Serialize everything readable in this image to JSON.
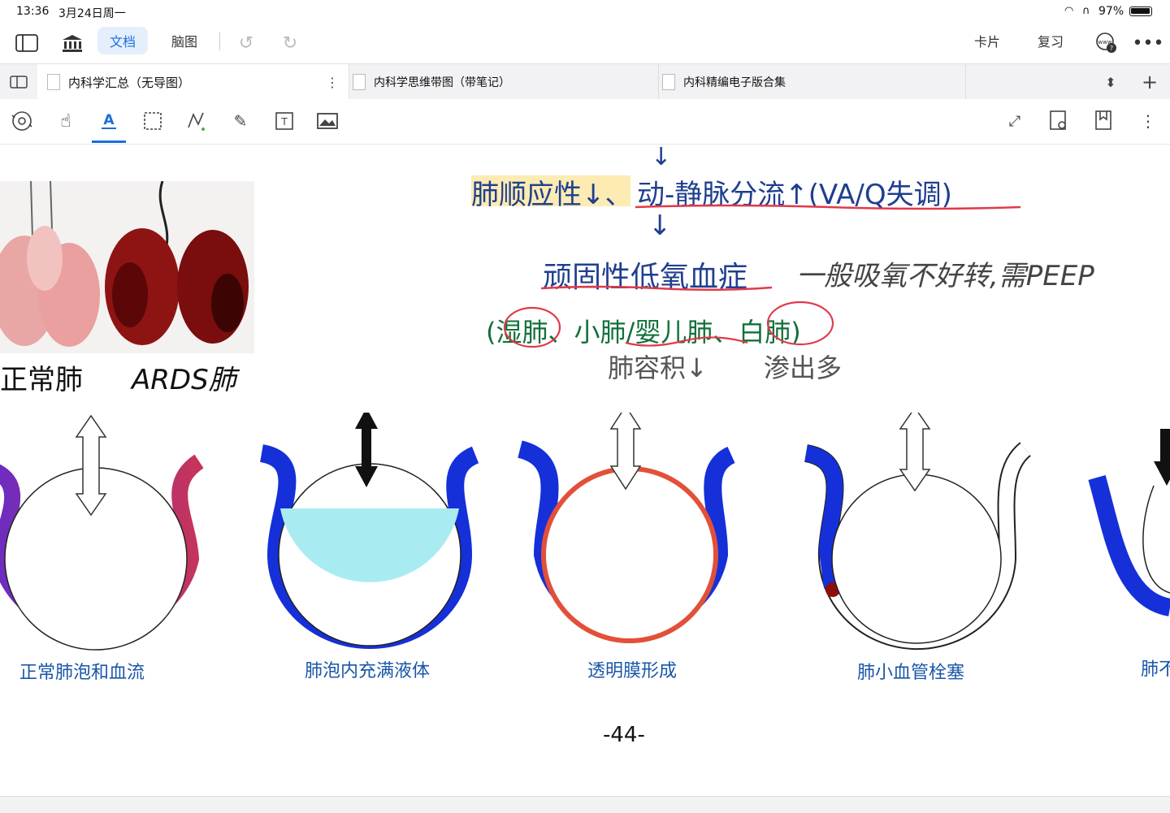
{
  "status": {
    "time": "13:36",
    "date": "3月24日周一",
    "battery": "97%"
  },
  "topbar": {
    "seg_doc": "文档",
    "seg_mindmap": "脑图",
    "card": "卡片",
    "review": "复习"
  },
  "tabs": [
    {
      "label": "内科学汇总（无导图）"
    },
    {
      "label": "内科学思维带图（带笔记）"
    },
    {
      "label": "内科精编电子版合集"
    }
  ],
  "notes": {
    "line1_a": "肺顺应性↓、",
    "line1_b": "动-静脉分流↑(VA/Q失调)",
    "line2_a": "顽固性低氧血症",
    "line2_b": "一般吸氧不好转,需PEEP",
    "line3": "(湿肺、小肺/婴儿肺、白肺)",
    "line4_a": "肺容积↓",
    "line4_b": "渗出多",
    "photo_label_left": "正常肺",
    "photo_label_right": "ARDS肺"
  },
  "diagrams": [
    {
      "caption": "正常肺泡和血流"
    },
    {
      "caption": "肺泡内充满液体"
    },
    {
      "caption": "透明膜形成"
    },
    {
      "caption": "肺小血管栓塞"
    },
    {
      "caption": "肺不"
    }
  ],
  "page_number": "-44-",
  "colors": {
    "accent": "#1a6fd8",
    "ink_blue": "#1f3f8f",
    "ink_green": "#12703a",
    "highlight": "#fbe7a6",
    "vessel_blue": "#1530d8",
    "fluid": "#a8ecf2",
    "membrane": "#e2503a"
  }
}
